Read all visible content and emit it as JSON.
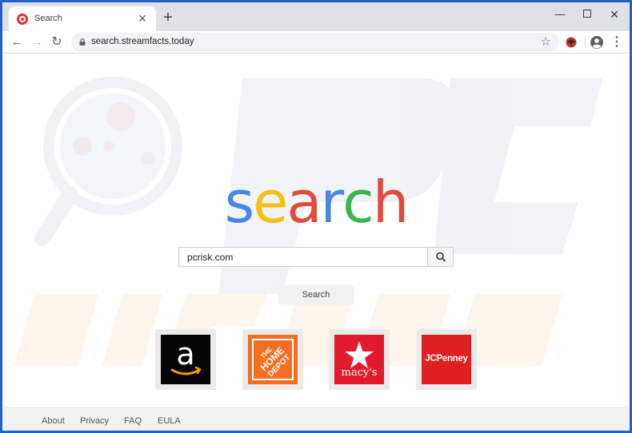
{
  "tab": {
    "title": "Search",
    "close_glyph": "✕",
    "new_tab_glyph": "+"
  },
  "window_controls": {
    "minimize": "—",
    "close": "✕"
  },
  "toolbar": {
    "back_glyph": "←",
    "forward_glyph": "→",
    "reload_glyph": "↻",
    "url": "search.streamfacts.today",
    "star_glyph": "☆",
    "menu_glyph": "⋮"
  },
  "logo": {
    "letters": [
      {
        "char": "s",
        "color": "#4a86e8"
      },
      {
        "char": "e",
        "color": "#f4c20d"
      },
      {
        "char": "a",
        "color": "#e04b3c"
      },
      {
        "char": "r",
        "color": "#4a86e8"
      },
      {
        "char": "c",
        "color": "#3cb650"
      },
      {
        "char": "h",
        "color": "#e04b3c"
      }
    ]
  },
  "search": {
    "value": "pcrisk.com",
    "button_label": "Search"
  },
  "tiles": {
    "amazon": {
      "icon": "amazon-logo-icon",
      "letter": "a"
    },
    "homedepot": {
      "icon": "home-depot-logo-icon",
      "line1": "THE",
      "line2": "HOME",
      "line3": "DEPOT"
    },
    "macys": {
      "icon": "macys-logo-icon",
      "text": "macy's"
    },
    "jcpenney": {
      "icon": "jcpenney-logo-icon",
      "text": "JCPenney"
    }
  },
  "footer": {
    "links": [
      "About",
      "Privacy",
      "FAQ",
      "EULA"
    ]
  },
  "colors": {
    "window_border": "#1f63c8",
    "tabstrip": "#dee1e6",
    "amazon": "#050505",
    "homedepot": "#f26f21",
    "macys": "#e21a2c",
    "jcpenney": "#e02020"
  }
}
